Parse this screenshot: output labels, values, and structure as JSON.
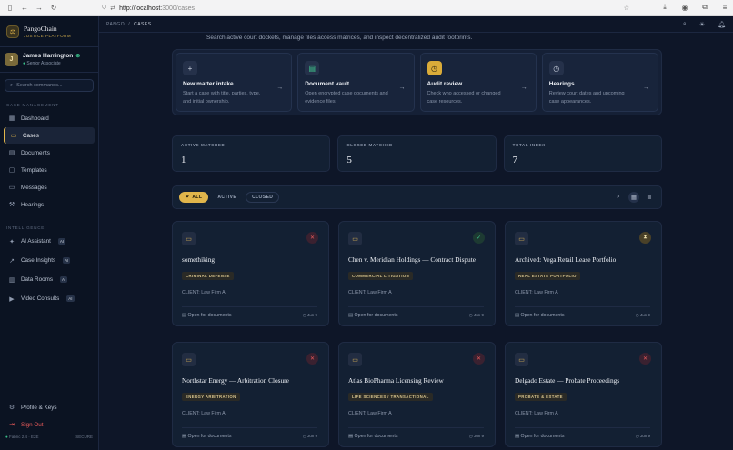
{
  "browser": {
    "url_host": "http://localhost:",
    "url_path": "3000/cases"
  },
  "brand": {
    "name": "PangoChain",
    "subtitle": "JUSTICE PLATFORM"
  },
  "user": {
    "name": "James Harrington",
    "role": "Senior Associate",
    "initial": "J"
  },
  "search": {
    "placeholder": "Search commands..."
  },
  "sections": {
    "case_management": "CASE MANAGEMENT",
    "intelligence": "INTELLIGENCE"
  },
  "nav_case": [
    {
      "label": "Dashboard",
      "icon": "grid-icon"
    },
    {
      "label": "Cases",
      "icon": "folder-icon",
      "active": true
    },
    {
      "label": "Documents",
      "icon": "document-icon"
    },
    {
      "label": "Templates",
      "icon": "template-icon"
    },
    {
      "label": "Messages",
      "icon": "message-icon"
    },
    {
      "label": "Hearings",
      "icon": "gavel-icon"
    }
  ],
  "nav_intel": [
    {
      "label": "AI Assistant",
      "badge": "AI"
    },
    {
      "label": "Case Insights",
      "badge": "AI"
    },
    {
      "label": "Data Rooms",
      "badge": "AI"
    },
    {
      "label": "Video Consults",
      "badge": "AI"
    }
  ],
  "nav_bottom": {
    "profile": "Profile & Keys",
    "signout": "Sign Out"
  },
  "footer": {
    "version": "Fabric 2.4 · E2E",
    "status": "SECURE"
  },
  "breadcrumb": {
    "root": "PANGO",
    "sep": "/",
    "current": "CASES"
  },
  "intro": "Search active court dockets, manage files access matrices, and inspect decentralized audit footprints.",
  "actions": [
    {
      "title": "New matter intake",
      "desc": "Start a case with title, parties, type, and initial ownership."
    },
    {
      "title": "Document vault",
      "desc": "Open encrypted case documents and evidence files."
    },
    {
      "title": "Audit review",
      "desc": "Check who accessed or changed case resources."
    },
    {
      "title": "Hearings",
      "desc": "Review court dates and upcoming case appearances."
    }
  ],
  "stats": [
    {
      "label": "ACTIVE MATCHED",
      "value": "1"
    },
    {
      "label": "CLOSED MATCHED",
      "value": "5"
    },
    {
      "label": "TOTAL INDEX",
      "value": "7"
    }
  ],
  "filters": {
    "all": "ALL",
    "active": "ACTIVE",
    "closed": "CLOSED"
  },
  "cases": [
    {
      "title": "somethiking",
      "tag": "CRIMINAL DEFENSE",
      "client": "CLIENT: Law Firm A",
      "open": "Open for documents",
      "date": "Jun 9",
      "status": "closed"
    },
    {
      "title": "Chen v. Meridian Holdings — Contract Dispute",
      "tag": "COMMERCIAL LITIGATION",
      "client": "CLIENT: Law Firm A",
      "open": "Open for documents",
      "date": "Jun 9",
      "status": "open"
    },
    {
      "title": "Archived: Vega Retail Lease Portfolio",
      "tag": "REAL ESTATE PORTFOLIO",
      "client": "CLIENT: Law Firm A",
      "open": "Open for documents",
      "date": "Jun 9",
      "status": "pending"
    },
    {
      "title": "Northstar Energy — Arbitration Closure",
      "tag": "ENERGY ARBITRATION",
      "client": "CLIENT: Law Firm A",
      "open": "Open for documents",
      "date": "Jun 9",
      "status": "closed"
    },
    {
      "title": "Atlas BioPharma Licensing Review",
      "tag": "LIFE SCIENCES / TRANSACTIONAL",
      "client": "CLIENT: Law Firm A",
      "open": "Open for documents",
      "date": "Jun 9",
      "status": "closed"
    },
    {
      "title": "Delgado Estate — Probate Proceedings",
      "tag": "PROBATE & ESTATE",
      "client": "CLIENT: Law Firm A",
      "open": "Open for documents",
      "date": "Jun 9",
      "status": "closed"
    }
  ]
}
